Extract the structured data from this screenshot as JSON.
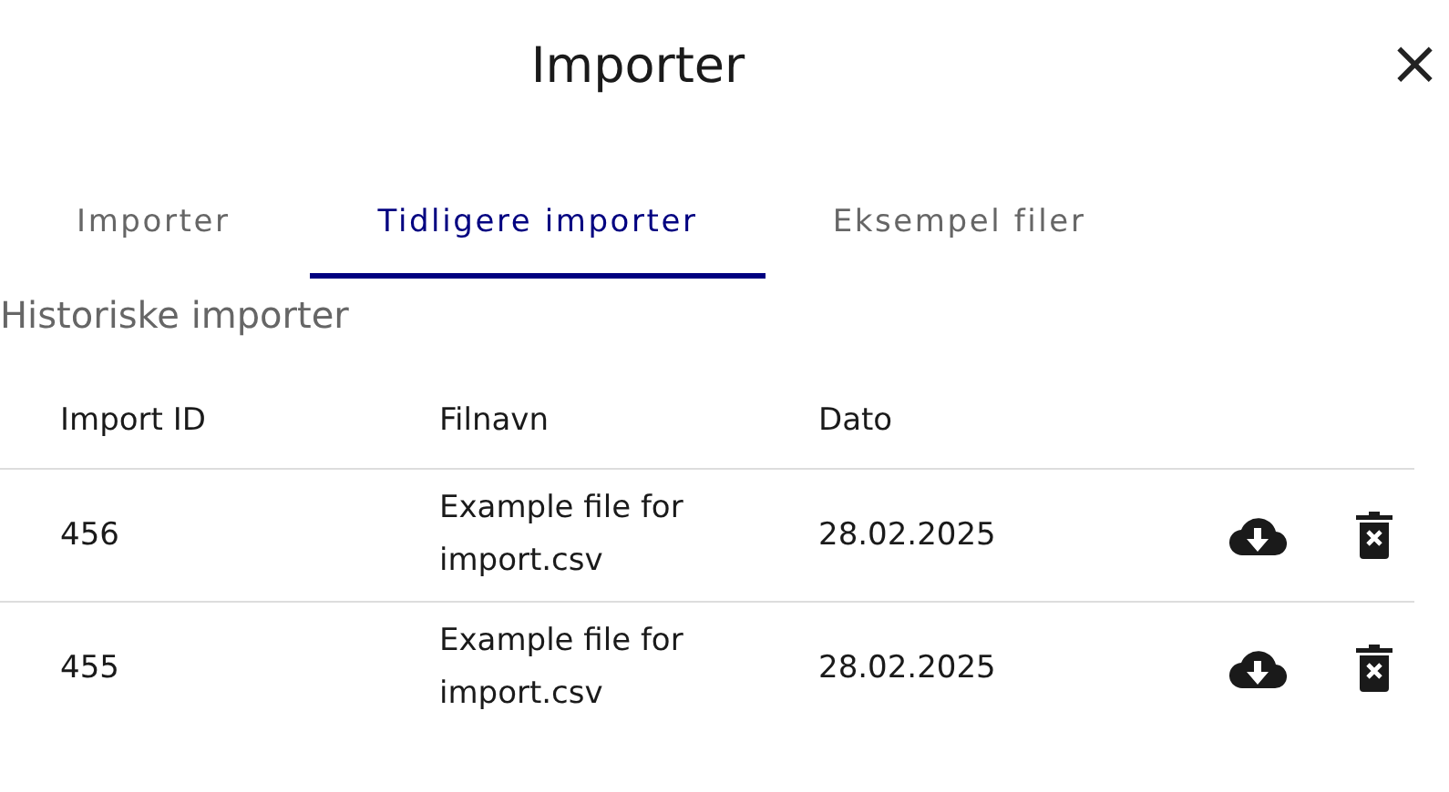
{
  "dialog": {
    "title": "Importer",
    "close": "×"
  },
  "tabs": [
    {
      "label": "Importer",
      "selected": false
    },
    {
      "label": "Tidligere importer",
      "selected": true
    },
    {
      "label": "Eksempel filer",
      "selected": false
    }
  ],
  "section_title": "Historiske importer",
  "table": {
    "columns": [
      "Import ID",
      "Filnavn",
      "Dato"
    ],
    "rows": [
      {
        "id": "456",
        "file": "Example file for import.csv",
        "date": "28.02.2025"
      },
      {
        "id": "455",
        "file": "Example file for import.csv",
        "date": "28.02.2025"
      }
    ]
  }
}
